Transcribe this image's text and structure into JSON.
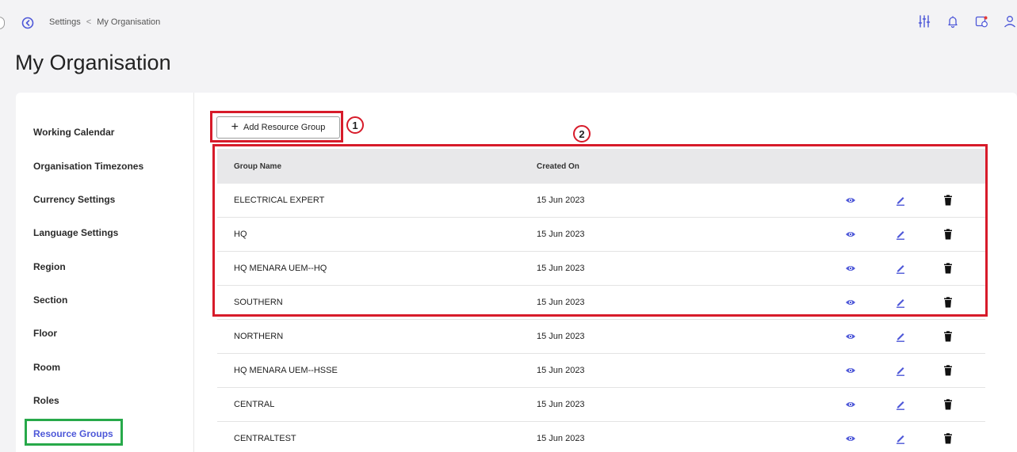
{
  "breadcrumb": {
    "parent": "Settings",
    "separator": "<",
    "current": "My Organisation"
  },
  "page": {
    "title": "My Organisation"
  },
  "sidebar": {
    "items": [
      {
        "label": "Working Calendar"
      },
      {
        "label": "Organisation Timezones"
      },
      {
        "label": "Currency Settings"
      },
      {
        "label": "Language Settings"
      },
      {
        "label": "Region"
      },
      {
        "label": "Section"
      },
      {
        "label": "Floor"
      },
      {
        "label": "Room"
      },
      {
        "label": "Roles"
      },
      {
        "label": "Resource Groups",
        "active": true
      }
    ]
  },
  "toolbar": {
    "add_label": "Add Resource Group"
  },
  "annotations": {
    "badge1": "1",
    "badge2": "2"
  },
  "table": {
    "columns": [
      "Group Name",
      "Created On"
    ],
    "rows": [
      {
        "name": "ELECTRICAL EXPERT",
        "created": "15 Jun 2023"
      },
      {
        "name": "HQ",
        "created": "15 Jun 2023"
      },
      {
        "name": "HQ MENARA UEM--HQ",
        "created": "15 Jun 2023"
      },
      {
        "name": "SOUTHERN",
        "created": "15 Jun 2023"
      },
      {
        "name": "NORTHERN",
        "created": "15 Jun 2023"
      },
      {
        "name": "HQ MENARA UEM--HSSE",
        "created": "15 Jun 2023"
      },
      {
        "name": "CENTRAL",
        "created": "15 Jun 2023"
      },
      {
        "name": "CENTRALTEST",
        "created": "15 Jun 2023"
      }
    ]
  },
  "colors": {
    "accent": "#4d57d8",
    "highlight_red": "#d71b2a",
    "highlight_green": "#27a94a"
  },
  "icons": {
    "back": "arrow-left-circle-icon",
    "top": [
      "sliders-icon",
      "bell-icon",
      "calendar-check-icon",
      "user-icon"
    ],
    "row_actions": [
      "eye-icon",
      "pencil-icon",
      "trash-icon"
    ]
  }
}
